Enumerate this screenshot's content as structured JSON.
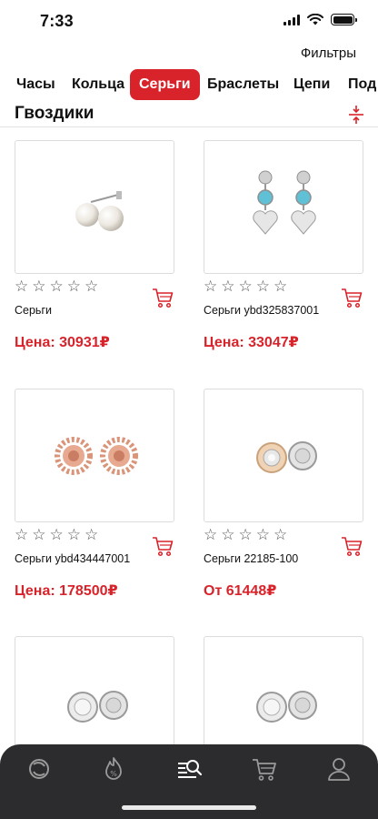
{
  "status_bar": {
    "time": "7:33"
  },
  "filters": {
    "label": "Фильтры"
  },
  "tabs": [
    {
      "label": "Часы",
      "active": false
    },
    {
      "label": "Кольца",
      "active": false
    },
    {
      "label": "Серьги",
      "active": true
    },
    {
      "label": "Браслеты",
      "active": false
    },
    {
      "label": "Цепи",
      "active": false
    },
    {
      "label": "Под",
      "active": false
    }
  ],
  "section": {
    "title": "Гвоздики"
  },
  "colors": {
    "accent": "#d8232a",
    "nav_bg": "#2c2c2e",
    "nav_icon": "#9a9a9a"
  },
  "products": [
    {
      "name": "Серьги",
      "price": "Цена: 30931₽",
      "image": "pearl-stud-earrings",
      "rating": 0
    },
    {
      "name": "Серьги ybd325837001",
      "price": "Цена: 33047₽",
      "image": "heart-drop-earrings",
      "rating": 0
    },
    {
      "name": "Серьги ybd434447001",
      "price": "Цена: 178500₽",
      "image": "rose-gold-flower-earrings",
      "rating": 0
    },
    {
      "name": "Серьги 22185-100",
      "price": "От 61448₽",
      "image": "round-stud-earrings-two-tone",
      "rating": 0
    },
    {
      "name": "",
      "price": "",
      "image": "round-stud-earrings-silver",
      "rating": 0
    },
    {
      "name": "",
      "price": "",
      "image": "round-stud-earrings-silver-2",
      "rating": 0
    }
  ],
  "bottom_nav": [
    {
      "icon": "catalog-swirl-icon",
      "active": false
    },
    {
      "icon": "discount-flame-icon",
      "active": false
    },
    {
      "icon": "search-list-icon",
      "active": true
    },
    {
      "icon": "cart-icon",
      "active": false
    },
    {
      "icon": "profile-icon",
      "active": false
    }
  ]
}
